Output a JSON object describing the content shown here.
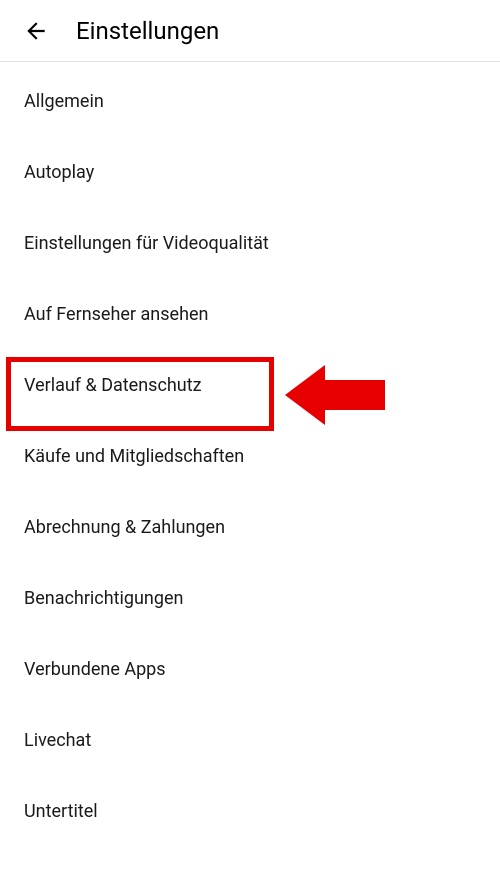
{
  "header": {
    "title": "Einstellungen"
  },
  "settings": {
    "items": [
      {
        "label": "Allgemein"
      },
      {
        "label": "Autoplay"
      },
      {
        "label": "Einstellungen für Videoqualität"
      },
      {
        "label": "Auf Fernseher ansehen"
      },
      {
        "label": "Verlauf & Datenschutz"
      },
      {
        "label": "Käufe und Mitgliedschaften"
      },
      {
        "label": "Abrechnung & Zahlungen"
      },
      {
        "label": "Benachrichtigungen"
      },
      {
        "label": "Verbundene Apps"
      },
      {
        "label": "Livechat"
      },
      {
        "label": "Untertitel"
      }
    ]
  },
  "annotation": {
    "highlight_color": "#e60000"
  }
}
